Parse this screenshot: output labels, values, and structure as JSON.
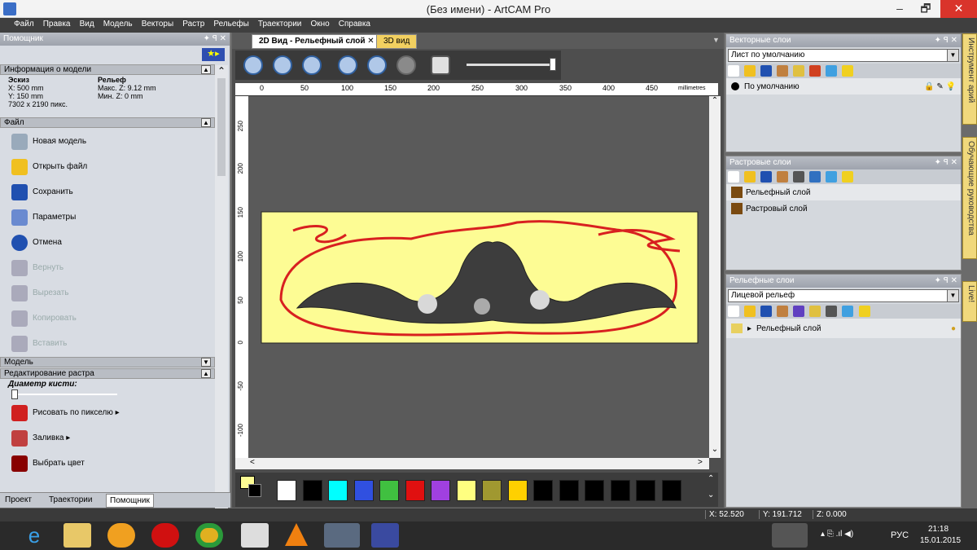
{
  "window": {
    "title": "(Без имени) - ArtCAM Pro",
    "min": "–",
    "max": "🗗",
    "close": "✕"
  },
  "menu": [
    "Файл",
    "Правка",
    "Вид",
    "Модель",
    "Векторы",
    "Растр",
    "Рельефы",
    "Траектории",
    "Окно",
    "Справка"
  ],
  "helper": {
    "title": "Помощник",
    "model_info": {
      "section": "Информация о модели",
      "sketch_label": "Эскиз",
      "relief_label": "Рельеф",
      "x": "X: 500 mm",
      "y": "Y: 150 mm",
      "pixels": "7302 x 2190 пикс.",
      "maxz": "Макс. Z: 9.12 mm",
      "minz": "Мин. Z: 0 mm"
    },
    "file_section": "Файл",
    "file_cmds": [
      "Новая модель",
      "Открыть файл",
      "Сохранить",
      "Параметры",
      "Отмена",
      "Вернуть",
      "Вырезать",
      "Копировать",
      "Вставить"
    ],
    "model_section": "Модель",
    "raster_section": "Редактирование растра",
    "brush_label": "Диаметр кисти:",
    "raster_cmds": [
      "Рисовать по пикселю ▸",
      "Заливка ▸",
      "Выбрать цвет"
    ],
    "bottom_tabs": [
      "Проект",
      "Траектории",
      "Помощник"
    ]
  },
  "doc": {
    "tabs": [
      "2D Вид - Рельефный слой",
      "3D вид"
    ],
    "ruler_units": "millimetres",
    "hticks": [
      "0",
      "50",
      "100",
      "150",
      "200",
      "250",
      "300",
      "350",
      "400",
      "450"
    ],
    "vticks": [
      "250",
      "200",
      "150",
      "100",
      "50",
      "0",
      "-50",
      "-100"
    ]
  },
  "vector_layers": {
    "title": "Векторные слои",
    "dropdown": "Лист по умолчанию",
    "rows": [
      "По умолчанию"
    ]
  },
  "raster_layers": {
    "title": "Растровые слои",
    "rows": [
      "Рельефный слой",
      "Растровый слой"
    ]
  },
  "relief_layers": {
    "title": "Рельефные слои",
    "dropdown": "Лицевой рельеф",
    "rows": [
      "Рельефный слой"
    ]
  },
  "side_tabs": [
    "Инструмент арий",
    "Обучающие руководства",
    "Live!"
  ],
  "status": {
    "x": "X: 52.520",
    "y": "Y: 191.712",
    "z": "Z: 0.000"
  },
  "taskbar": {
    "lang": "РУС",
    "time": "21:18",
    "date": "15.01.2015"
  },
  "palette": [
    "#ffffff",
    "#000000",
    "#00ffff",
    "#3050e0",
    "#40c040",
    "#e01010",
    "#a040e0",
    "#ffff80",
    "#a09830",
    "#ffd000",
    "#000000",
    "#000000",
    "#000000",
    "#000000",
    "#000000",
    "#000000"
  ]
}
